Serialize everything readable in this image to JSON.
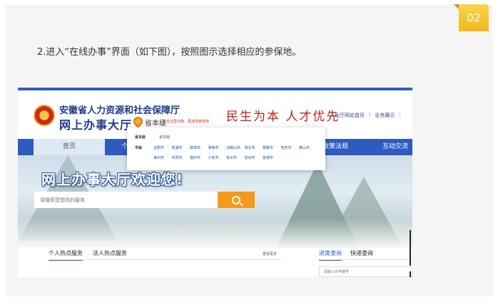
{
  "badge": "02",
  "intro": "2.进入“在线办事”界面（如下图），按照图示选择相应的参保地。",
  "header": {
    "org_name": "安徽省人力资源和社会保障厅",
    "site_title": "网上办事大厅",
    "location_label": "省本级",
    "location_hint": "点击这里切换：再选择参保地",
    "slogan": "民生为本  人才优先",
    "links": [
      "人社厅网站首页",
      "|",
      "业务展示",
      "|"
    ]
  },
  "nav": {
    "home": "首页",
    "item_2": "个",
    "item_laws": "政策法规",
    "item_interact": "互动交流"
  },
  "popup": {
    "province_label": "省本级",
    "province_value": "省本级",
    "city_label": "市级",
    "cities": [
      "合肥市",
      "芜湖市",
      "蚌埠市",
      "淮南市",
      "马鞍山市",
      "淮北市",
      "铜陵市",
      "安庆市",
      "黄山市",
      "滁州市",
      "阜阳市",
      "宿州市",
      "六安市",
      "亳州市",
      "池州市",
      "宣城市"
    ]
  },
  "banner": {
    "welcome": "网上办事大厅欢迎您!",
    "search_placeholder": "请搜索您想找的服务"
  },
  "services": {
    "tab_personal": "个人热点服务",
    "tab_legal": "法人热点服务",
    "more": "查看更多",
    "tab_progress": "进度查询",
    "tab_express": "快递查询",
    "order_placeholder": "请输入办件编号"
  },
  "colors": {
    "brand_blue": "#2d5cc1",
    "badge_yellow": "#f3c02b",
    "search_orange": "#f39a1a",
    "slogan_red": "#c8211a"
  }
}
